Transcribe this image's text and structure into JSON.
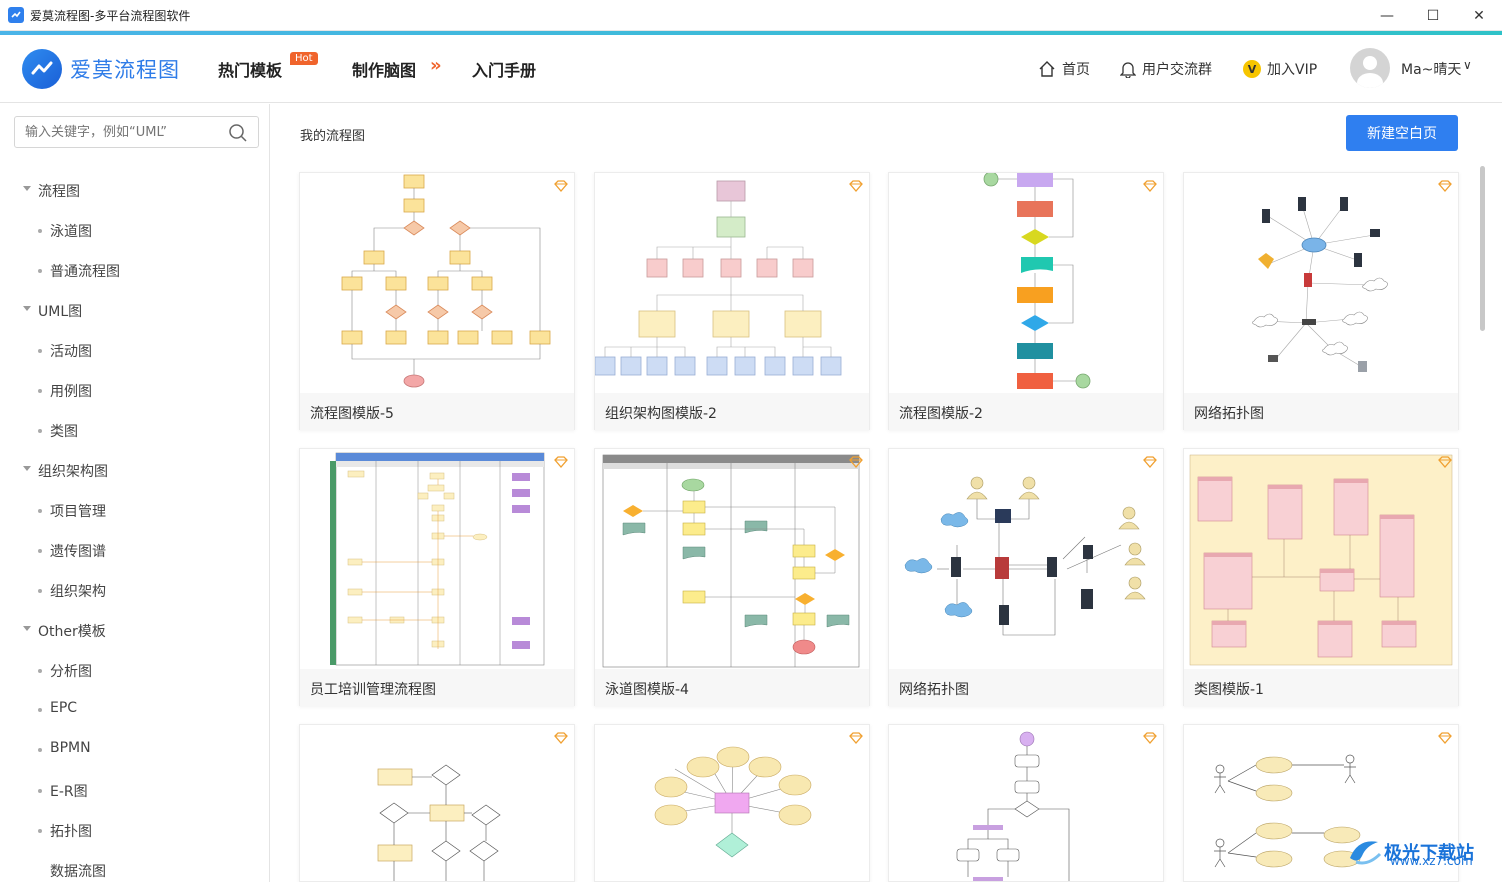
{
  "window": {
    "title": "爱莫流程图-多平台流程图软件",
    "controls": [
      "—",
      "☐",
      "✕"
    ]
  },
  "header": {
    "logo_text": "爱莫流程图",
    "nav": {
      "hot_templates": "热门模板",
      "hot_badge": "Hot",
      "make_mindmap": "制作脑图",
      "chevrons": "»",
      "getting_started": "入门手册"
    },
    "right": {
      "home": "首页",
      "user_group": "用户交流群",
      "vip": "加入VIP",
      "vip_icon_glyph": "V",
      "username": "Ma~晴天",
      "chevron": "∨"
    }
  },
  "sidebar": {
    "search_placeholder": "输入关键字，例如“UML”",
    "categories": [
      {
        "label": "流程图",
        "children": [
          "泳道图",
          "普通流程图"
        ]
      },
      {
        "label": "UML图",
        "children": [
          "活动图",
          "用例图",
          "类图"
        ]
      },
      {
        "label": "组织架构图",
        "children": [
          "项目管理",
          "遗传图谱",
          "组织架构"
        ]
      },
      {
        "label": "Other模板",
        "children": [
          "分析图",
          "EPC",
          "BPMN",
          "E-R图",
          "拓扑图",
          "数据流图"
        ]
      }
    ]
  },
  "main": {
    "section_title": "我的流程图",
    "new_button": "新建空白页",
    "cards": [
      {
        "title": "流程图模版-5"
      },
      {
        "title": "组织架构图模版-2"
      },
      {
        "title": "流程图模版-2"
      },
      {
        "title": "网络拓扑图"
      },
      {
        "title": "员工培训管理流程图"
      },
      {
        "title": "泳道图模版-4"
      },
      {
        "title": "网络拓扑图"
      },
      {
        "title": "类图模版-1"
      },
      {
        "title": ""
      },
      {
        "title": ""
      },
      {
        "title": ""
      },
      {
        "title": ""
      }
    ]
  },
  "watermark": {
    "text": "极光下载站",
    "url": "www.xz7.com"
  },
  "colors": {
    "accent": "#2f7ff0",
    "hot": "#f0642c",
    "vip": "#f7c500"
  }
}
